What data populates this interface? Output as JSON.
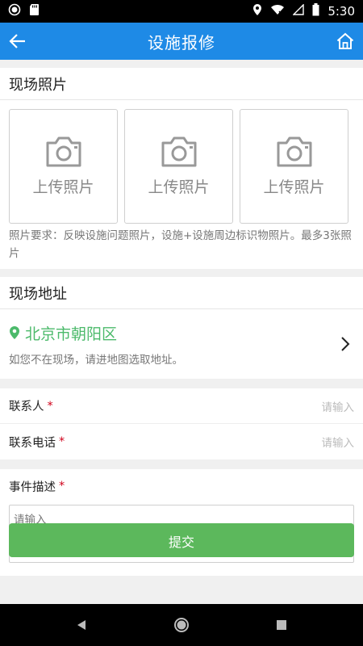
{
  "status_bar": {
    "time": "5:30"
  },
  "app_bar": {
    "title": "设施报修"
  },
  "photos_section": {
    "title": "现场照片",
    "items": [
      {
        "label": "上传照片"
      },
      {
        "label": "上传照片"
      },
      {
        "label": "上传照片"
      }
    ],
    "note": "照片要求：反映设施问题照片，设施+设施周边标识物照片。最多3张照片"
  },
  "address_section": {
    "title": "现场地址",
    "location": "北京市朝阳区",
    "hint": "如您不在现场，请进地图选取地址。"
  },
  "contact": {
    "name_label": "联系人",
    "name_placeholder": "请输入",
    "phone_label": "联系电话",
    "phone_placeholder": "请输入",
    "required_mark": "*"
  },
  "description": {
    "label": "事件描述",
    "required_mark": "*",
    "placeholder": "请输入"
  },
  "submit": {
    "label": "提交"
  },
  "colors": {
    "app_bar": "#1e8ae6",
    "location_green": "#4cba6b",
    "submit_green": "#5cb85c",
    "required_red": "#d0021b"
  }
}
